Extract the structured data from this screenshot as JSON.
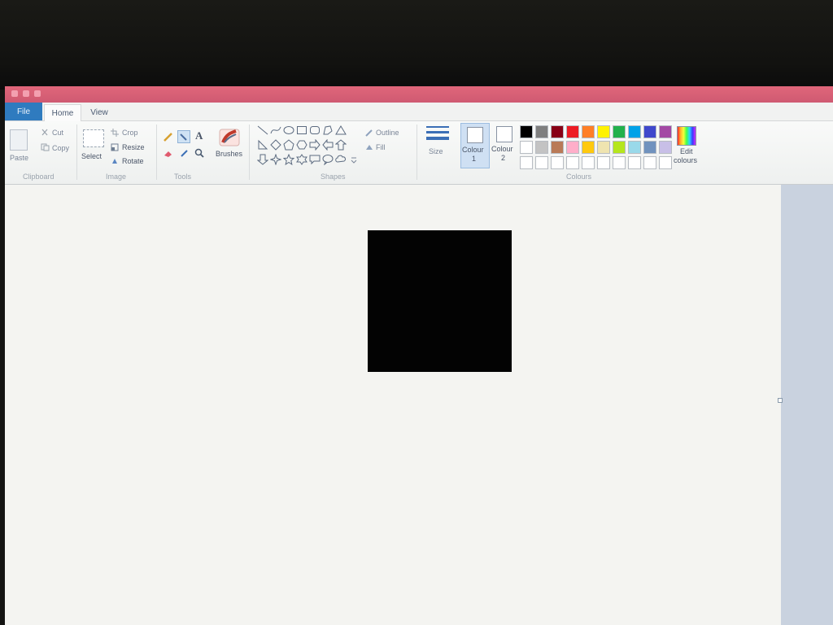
{
  "tabs": {
    "file": "File",
    "home": "Home",
    "view": "View"
  },
  "clipboard": {
    "paste": "Paste",
    "cut": "Cut",
    "copy": "Copy",
    "group": "Clipboard"
  },
  "image": {
    "select": "Select",
    "crop": "Crop",
    "resize": "Resize",
    "rotate": "Rotate",
    "group": "Image"
  },
  "tools": {
    "group": "Tools",
    "text_tool": "A"
  },
  "brushes": {
    "label": "Brushes"
  },
  "shapes": {
    "outline": "Outline",
    "fill": "Fill",
    "group": "Shapes"
  },
  "size": {
    "label": "Size"
  },
  "colour1": {
    "line1": "Colour",
    "line2": "1"
  },
  "colour2": {
    "line1": "Colour",
    "line2": "2"
  },
  "colours": {
    "group": "Colours",
    "edit_line1": "Edit",
    "edit_line2": "colours",
    "palette_row1": [
      "#000000",
      "#7f7f7f",
      "#880015",
      "#ed1c24",
      "#ff7f27",
      "#fff200",
      "#22b14c",
      "#00a2e8",
      "#3f48cc",
      "#a349a4"
    ],
    "palette_row2": [
      "#ffffff",
      "#c3c3c3",
      "#b97a57",
      "#ffaec9",
      "#ffc90e",
      "#efe4b0",
      "#b5e61d",
      "#99d9ea",
      "#7092be",
      "#c8bfe7"
    ],
    "palette_row3": [
      "#ffffff",
      "#ffffff",
      "#ffffff",
      "#ffffff",
      "#ffffff",
      "#ffffff",
      "#ffffff",
      "#ffffff",
      "#ffffff",
      "#ffffff"
    ]
  },
  "canvas": {
    "background": "#f4f4f1",
    "shape_color": "#030303"
  }
}
